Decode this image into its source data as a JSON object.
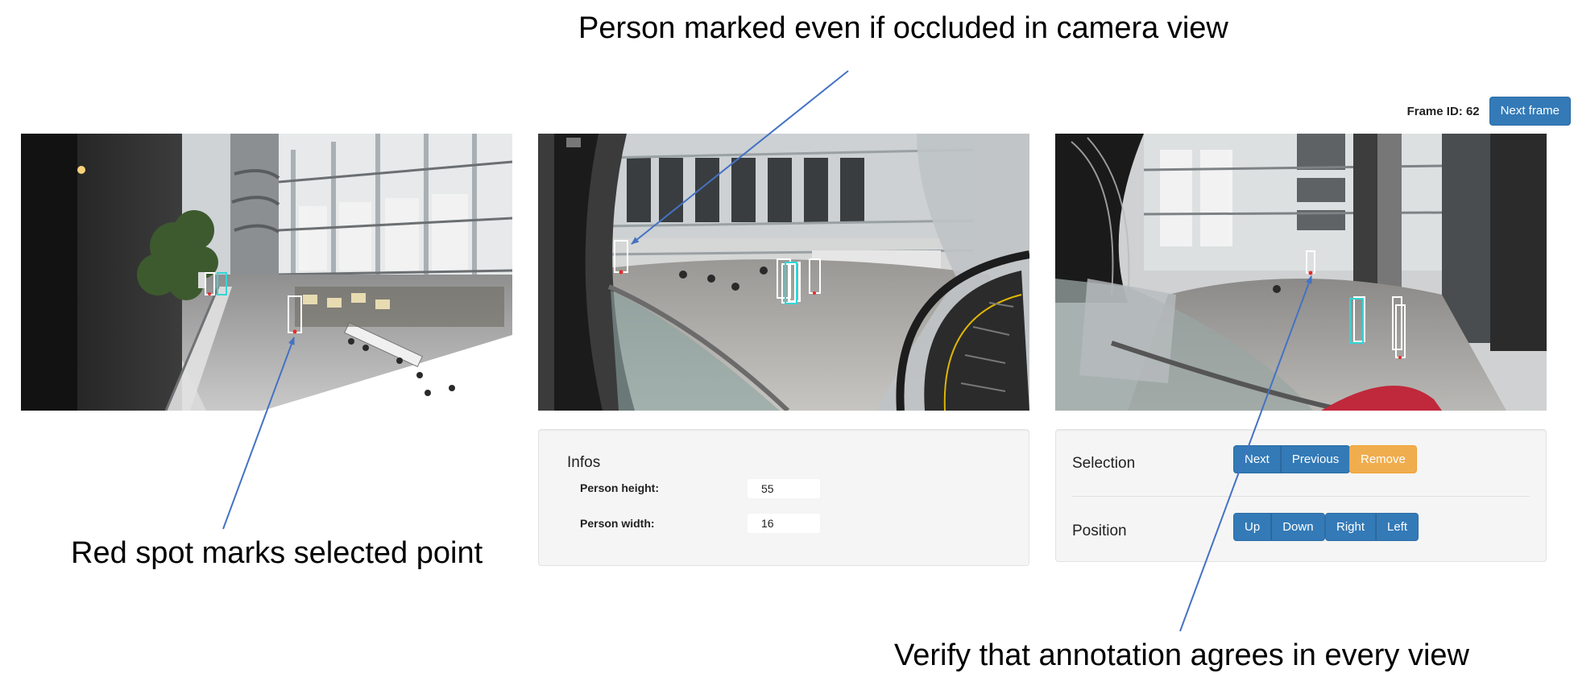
{
  "annotations": {
    "top": "Person marked even if occluded in camera view",
    "left": "Red spot marks selected point",
    "right": "Verify that annotation agrees in every view"
  },
  "toolbar": {
    "frame_label": "Frame ID: 62",
    "next_frame_label": "Next frame"
  },
  "infos": {
    "title": "Infos",
    "height_label": "Person height:",
    "height_value": "55",
    "width_label": "Person width:",
    "width_value": "16"
  },
  "selection": {
    "label": "Selection",
    "next_label": "Next",
    "previous_label": "Previous",
    "remove_label": "Remove"
  },
  "position": {
    "label": "Position",
    "up_label": "Up",
    "down_label": "Down",
    "right_label": "Right",
    "left_label": "Left"
  },
  "colors": {
    "primary": "#337ab7",
    "warning": "#f0ad4e",
    "arrow": "#4472c4",
    "box_selected": "#33d6d6",
    "box_other": "#ffffff",
    "point": "#e32b2b"
  }
}
